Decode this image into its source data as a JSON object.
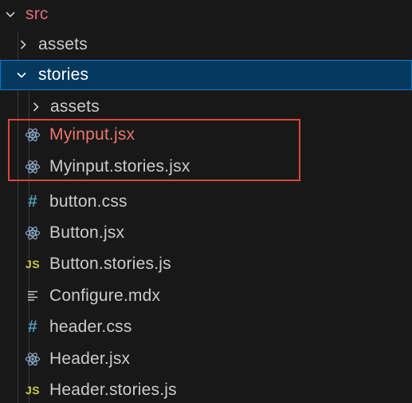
{
  "tree": {
    "root_folder": {
      "label": "src",
      "expanded": true
    },
    "assets_folder": {
      "label": "assets",
      "expanded": false
    },
    "stories_folder": {
      "label": "stories",
      "expanded": true,
      "selected": true
    },
    "stories_children": [
      {
        "label": "assets",
        "kind": "folder",
        "icon": "chevron-right-icon"
      },
      {
        "label": "Myinput.jsx",
        "kind": "file",
        "icon": "react-icon",
        "color": "#e8776a"
      },
      {
        "label": "Myinput.stories.jsx",
        "kind": "file",
        "icon": "react-icon"
      },
      {
        "label": "button.css",
        "kind": "file",
        "icon": "css-hash-icon"
      },
      {
        "label": "Button.jsx",
        "kind": "file",
        "icon": "react-icon"
      },
      {
        "label": "Button.stories.js",
        "kind": "file",
        "icon": "js-icon",
        "badge": "JS"
      },
      {
        "label": "Configure.mdx",
        "kind": "file",
        "icon": "mdx-lines-icon"
      },
      {
        "label": "header.css",
        "kind": "file",
        "icon": "css-hash-icon"
      },
      {
        "label": "Header.jsx",
        "kind": "file",
        "icon": "react-icon"
      },
      {
        "label": "Header.stories.js",
        "kind": "file",
        "icon": "js-icon",
        "badge": "JS"
      }
    ]
  },
  "annotation": {
    "color": "#e0453a"
  },
  "colors": {
    "background": "#181818",
    "selected_row": "#04395e",
    "react_icon": "#8fa9c9",
    "css_icon": "#519aba",
    "js_icon": "#cbcb41",
    "red_label": "#e8776a"
  }
}
